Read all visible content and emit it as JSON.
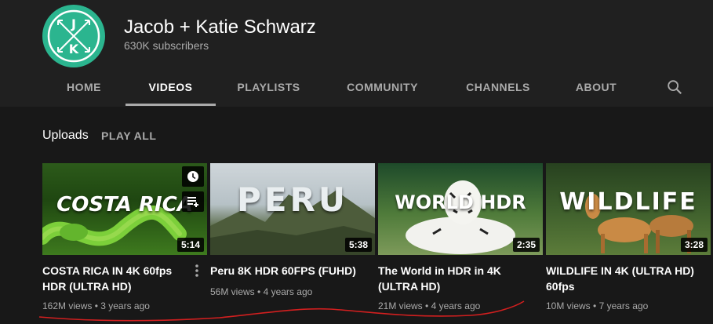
{
  "channel": {
    "name": "Jacob + Katie Schwarz",
    "subscribers": "630K subscribers",
    "avatar_letters": [
      "J",
      "K"
    ],
    "avatar_color": "#2bb58f"
  },
  "tabs": [
    {
      "label": "HOME",
      "active": false
    },
    {
      "label": "VIDEOS",
      "active": true
    },
    {
      "label": "PLAYLISTS",
      "active": false
    },
    {
      "label": "COMMUNITY",
      "active": false
    },
    {
      "label": "CHANNELS",
      "active": false
    },
    {
      "label": "ABOUT",
      "active": false
    }
  ],
  "section": {
    "title": "Uploads",
    "play_all": "PLAY ALL"
  },
  "videos": [
    {
      "thumb_text": "COSTA RICA",
      "duration": "5:14",
      "title": "COSTA RICA IN 4K 60fps HDR (ULTRA HD)",
      "views": "162M views",
      "age": "3 years ago"
    },
    {
      "thumb_text": "PERU",
      "duration": "5:38",
      "title": "Peru 8K HDR 60FPS (FUHD)",
      "views": "56M views",
      "age": "4 years ago"
    },
    {
      "thumb_text": "WORLD HDR",
      "duration": "2:35",
      "title": "The World in HDR in 4K (ULTRA HD)",
      "views": "21M views",
      "age": "4 years ago"
    },
    {
      "thumb_text": "WILDLIFE",
      "duration": "3:28",
      "title": "WILDLIFE IN 4K (ULTRA HD) 60fps",
      "views": "10M views",
      "age": "7 years ago"
    }
  ],
  "meta_separator": "•",
  "colors": {
    "background": "#181818",
    "header": "#202020",
    "annotation": "#d21f1f"
  }
}
